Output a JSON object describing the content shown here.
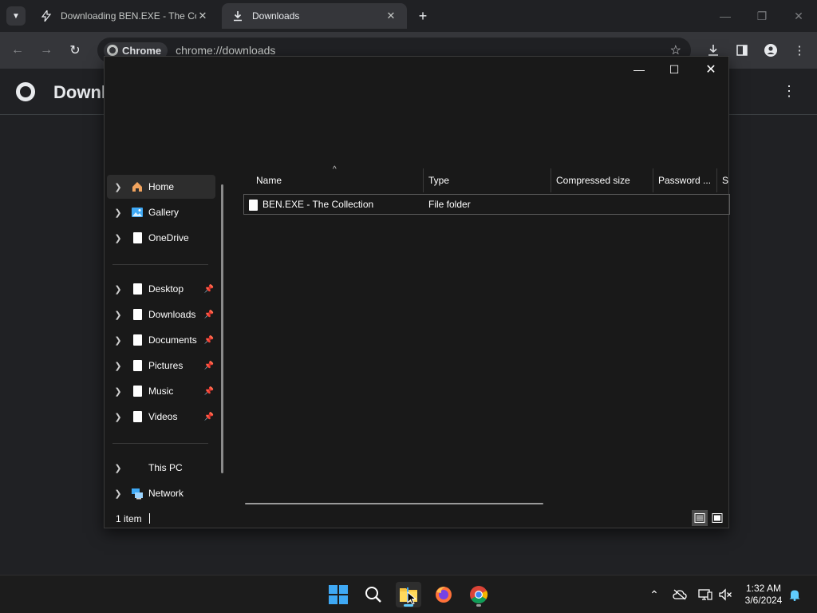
{
  "browser": {
    "tabs": [
      {
        "title": "Downloading BEN.EXE - The Co",
        "state": "inactive"
      },
      {
        "title": "Downloads",
        "state": "active"
      }
    ],
    "omnibox": {
      "chip_label": "Chrome",
      "url": "chrome://downloads"
    },
    "page_title": "Downlo"
  },
  "explorer": {
    "nav": {
      "quick": [
        {
          "label": "Home",
          "icon": "home-icon"
        },
        {
          "label": "Gallery",
          "icon": "gallery-icon"
        },
        {
          "label": "OneDrive",
          "icon": "file-icon"
        }
      ],
      "pinned": [
        {
          "label": "Desktop",
          "icon": "file-icon"
        },
        {
          "label": "Downloads",
          "icon": "file-icon"
        },
        {
          "label": "Documents",
          "icon": "file-icon"
        },
        {
          "label": "Pictures",
          "icon": "file-icon"
        },
        {
          "label": "Music",
          "icon": "file-icon"
        },
        {
          "label": "Videos",
          "icon": "file-icon"
        }
      ],
      "system": [
        {
          "label": "This PC",
          "icon": ""
        },
        {
          "label": "Network",
          "icon": "network-icon"
        }
      ]
    },
    "columns": [
      "Name",
      "Type",
      "Compressed size",
      "Password ...",
      "Si"
    ],
    "rows": [
      {
        "name": "BEN.EXE - The Collection",
        "type": "File folder",
        "compressed_size": "",
        "password": ""
      }
    ],
    "status": {
      "count": "1 item"
    }
  },
  "taskbar": {
    "clock": {
      "time": "1:32 AM",
      "date": "3/6/2024"
    }
  },
  "colors": {
    "accent": "#60cdff",
    "windows_logo": "#3fa9f5",
    "folder": "#f5c342"
  }
}
